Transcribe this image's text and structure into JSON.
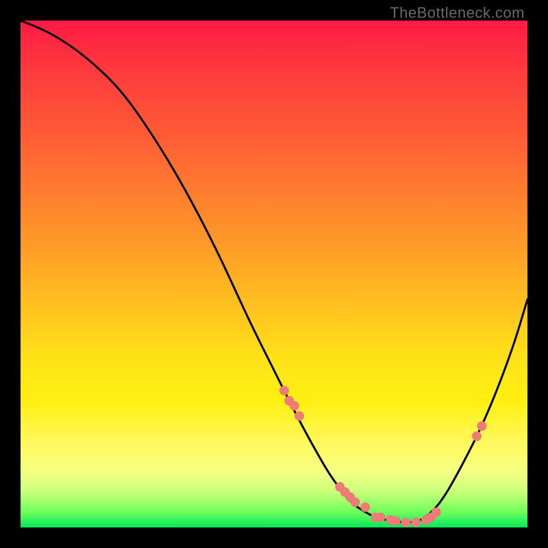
{
  "watermark": "TheBottleneck.com",
  "chart_data": {
    "type": "line",
    "title": "",
    "xlabel": "",
    "ylabel": "",
    "xlim": [
      0,
      100
    ],
    "ylim": [
      0,
      100
    ],
    "grid": false,
    "legend": false,
    "curve": {
      "name": "bottleneck-curve",
      "x": [
        0,
        5,
        10,
        15,
        20,
        25,
        30,
        35,
        40,
        45,
        50,
        55,
        60,
        62,
        65,
        68,
        70,
        72,
        75,
        78,
        80,
        83,
        87,
        92,
        97,
        100
      ],
      "y": [
        100,
        98,
        95,
        91,
        86,
        79,
        71,
        62,
        52,
        41,
        31,
        21,
        12,
        9,
        5,
        3,
        2,
        1.5,
        1,
        1,
        2,
        5,
        12,
        22,
        35,
        45
      ]
    },
    "markers": {
      "name": "highlight-points",
      "color": "#ee7b78",
      "x": [
        52,
        53,
        54,
        55,
        63,
        64,
        65,
        66,
        68,
        70,
        71,
        73,
        74,
        76,
        78,
        80,
        81,
        82,
        90,
        91
      ],
      "y": [
        27,
        25,
        24,
        22,
        8,
        7,
        6,
        5,
        4,
        2,
        2,
        1.5,
        1.3,
        1,
        1,
        1.5,
        2,
        3,
        18,
        20
      ]
    }
  }
}
